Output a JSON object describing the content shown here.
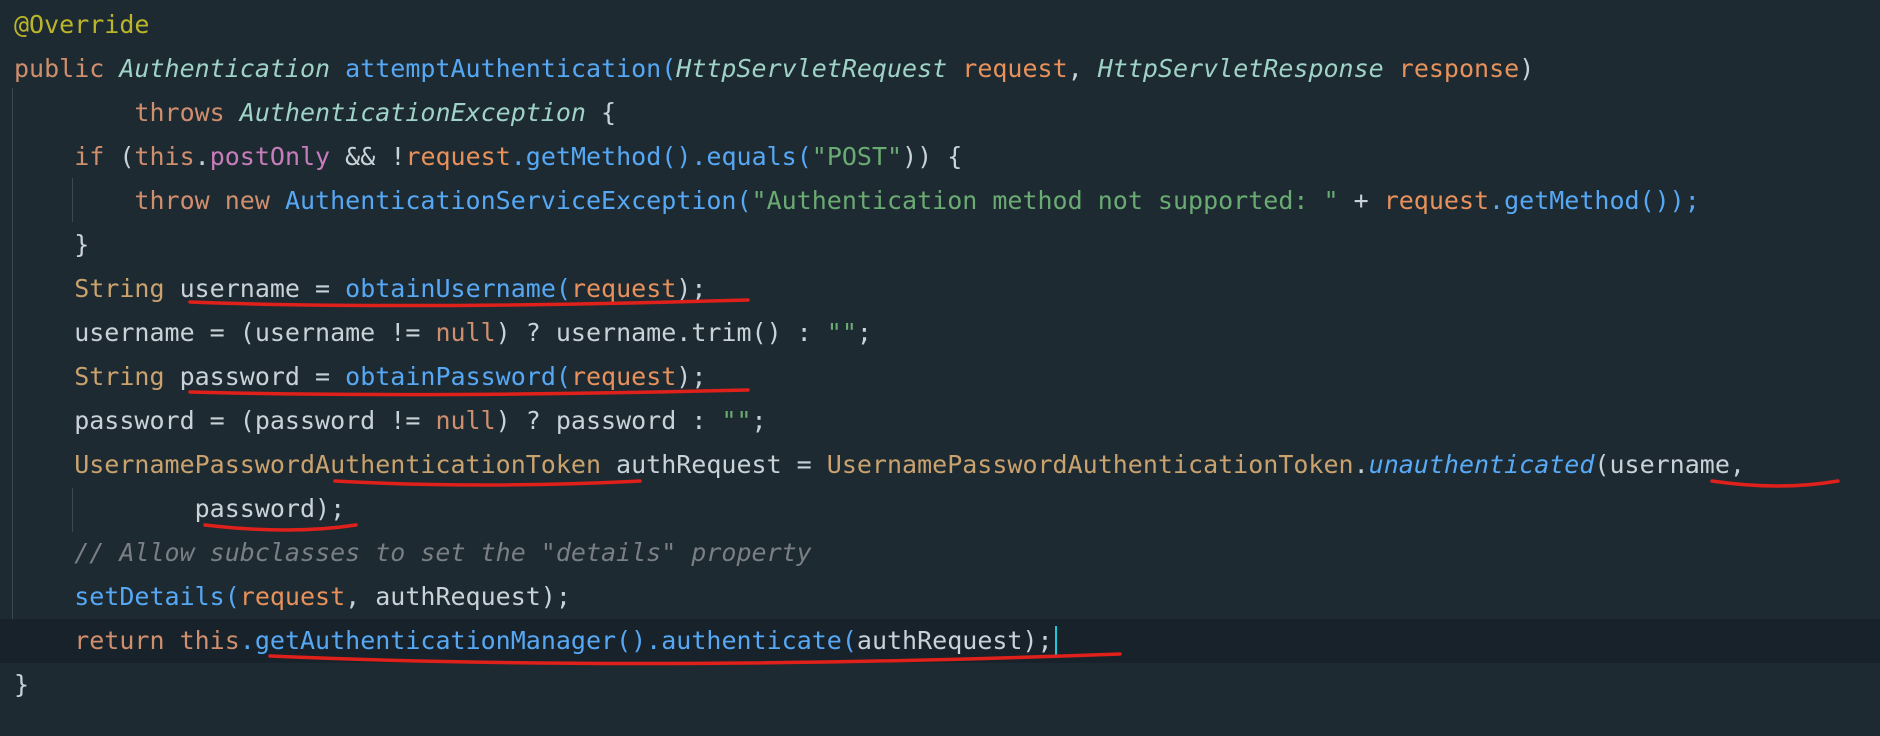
{
  "editor": {
    "lines": [
      {
        "id": "l1",
        "tokens": [
          {
            "t": "@Override",
            "c": "c-annotation"
          }
        ]
      },
      {
        "id": "l2",
        "tokens": [
          {
            "t": "public ",
            "c": "c-kw"
          },
          {
            "t": "Authentication",
            "c": "c-type-it"
          },
          {
            "t": " attemptAuthentication(",
            "c": "c-method"
          },
          {
            "t": "HttpServletRequest",
            "c": "c-type-it"
          },
          {
            "t": " ",
            "c": "c-plain"
          },
          {
            "t": "request",
            "c": "c-param"
          },
          {
            "t": ", ",
            "c": "c-plain"
          },
          {
            "t": "HttpServletResponse",
            "c": "c-type-it"
          },
          {
            "t": " ",
            "c": "c-plain"
          },
          {
            "t": "response",
            "c": "c-param"
          },
          {
            "t": ")",
            "c": "c-plain"
          }
        ]
      },
      {
        "id": "l3",
        "tokens": [
          {
            "t": "        throws ",
            "c": "c-kw"
          },
          {
            "t": "AuthenticationException",
            "c": "c-type-it"
          },
          {
            "t": " {",
            "c": "c-plain"
          }
        ]
      },
      {
        "id": "l4",
        "tokens": [
          {
            "t": "    if ",
            "c": "c-kw"
          },
          {
            "t": "(",
            "c": "c-plain"
          },
          {
            "t": "this",
            "c": "c-kw"
          },
          {
            "t": ".",
            "c": "c-plain"
          },
          {
            "t": "postOnly",
            "c": "c-field"
          },
          {
            "t": " && !",
            "c": "c-plain"
          },
          {
            "t": "request",
            "c": "c-param"
          },
          {
            "t": ".getMethod().equals(",
            "c": "c-method"
          },
          {
            "t": "\"POST\"",
            "c": "c-string"
          },
          {
            "t": ")) {",
            "c": "c-plain"
          }
        ]
      },
      {
        "id": "l5",
        "tokens": [
          {
            "t": "        throw new ",
            "c": "c-kw"
          },
          {
            "t": "AuthenticationServiceException(",
            "c": "c-method"
          },
          {
            "t": "\"Authentication method not supported: \"",
            "c": "c-string"
          },
          {
            "t": " + ",
            "c": "c-plain"
          },
          {
            "t": "request",
            "c": "c-param"
          },
          {
            "t": ".getMethod());",
            "c": "c-method"
          }
        ]
      },
      {
        "id": "l6",
        "tokens": [
          {
            "t": "    }",
            "c": "c-plain"
          }
        ]
      },
      {
        "id": "l7",
        "tokens": [
          {
            "t": "    String ",
            "c": "c-type"
          },
          {
            "t": "username = ",
            "c": "c-plain"
          },
          {
            "t": "obtainUsername(",
            "c": "c-method"
          },
          {
            "t": "request",
            "c": "c-param"
          },
          {
            "t": ");",
            "c": "c-plain"
          }
        ]
      },
      {
        "id": "l8",
        "tokens": [
          {
            "t": "    username = (username != ",
            "c": "c-plain"
          },
          {
            "t": "null",
            "c": "c-kw"
          },
          {
            "t": ") ? username.trim() : ",
            "c": "c-plain"
          },
          {
            "t": "\"\"",
            "c": "c-string"
          },
          {
            "t": ";",
            "c": "c-plain"
          }
        ]
      },
      {
        "id": "l9",
        "tokens": [
          {
            "t": "    String ",
            "c": "c-type"
          },
          {
            "t": "password = ",
            "c": "c-plain"
          },
          {
            "t": "obtainPassword(",
            "c": "c-method"
          },
          {
            "t": "request",
            "c": "c-param"
          },
          {
            "t": ");",
            "c": "c-plain"
          }
        ]
      },
      {
        "id": "l10",
        "tokens": [
          {
            "t": "    password = (password != ",
            "c": "c-plain"
          },
          {
            "t": "null",
            "c": "c-kw"
          },
          {
            "t": ") ? password : ",
            "c": "c-plain"
          },
          {
            "t": "\"\"",
            "c": "c-string"
          },
          {
            "t": ";",
            "c": "c-plain"
          }
        ]
      },
      {
        "id": "l11",
        "tokens": [
          {
            "t": "    UsernamePasswordAuthenticationToken",
            "c": "c-type"
          },
          {
            "t": " authRequest = ",
            "c": "c-plain"
          },
          {
            "t": "UsernamePasswordAuthenticationToken",
            "c": "c-type"
          },
          {
            "t": ".",
            "c": "c-plain"
          },
          {
            "t": "unauthenticated",
            "c": "c-static"
          },
          {
            "t": "(username,",
            "c": "c-plain"
          }
        ]
      },
      {
        "id": "l12",
        "tokens": [
          {
            "t": "            password);",
            "c": "c-plain"
          }
        ]
      },
      {
        "id": "l13",
        "tokens": [
          {
            "t": "    // Allow subclasses to set the \"details\" property",
            "c": "c-comment"
          }
        ]
      },
      {
        "id": "l14",
        "tokens": [
          {
            "t": "    setDetails(",
            "c": "c-method"
          },
          {
            "t": "request",
            "c": "c-param"
          },
          {
            "t": ", authRequest);",
            "c": "c-plain"
          }
        ]
      },
      {
        "id": "l15",
        "current": true,
        "tokens": [
          {
            "t": "    return ",
            "c": "c-kw"
          },
          {
            "t": "this",
            "c": "c-kw"
          },
          {
            "t": ".getAuthenticationManager().authenticate(",
            "c": "c-method"
          },
          {
            "t": "authRequest",
            "c": "c-plain"
          },
          {
            "t": ");",
            "c": "c-plain"
          }
        ]
      },
      {
        "id": "l16",
        "tokens": [
          {
            "t": "}",
            "c": "c-plain"
          }
        ]
      }
    ]
  },
  "colors": {
    "background": "#1e2a31",
    "current_line": "#18222a",
    "underline_mark": "#e0201a",
    "caret": "#1ec9d8"
  }
}
